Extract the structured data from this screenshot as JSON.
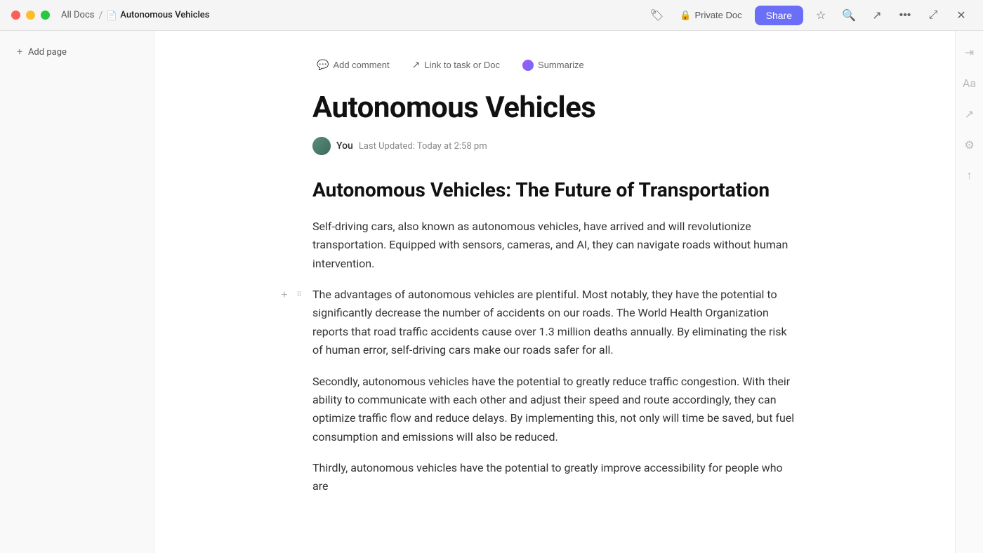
{
  "titlebar": {
    "breadcrumb_all": "All Docs",
    "breadcrumb_separator": "/",
    "breadcrumb_current": "Autonomous Vehicles",
    "private_label": "Private Doc",
    "share_label": "Share"
  },
  "sidebar": {
    "add_page_label": "Add page"
  },
  "toolbar": {
    "add_comment": "Add comment",
    "link_to_task": "Link to task or Doc",
    "summarize": "Summarize"
  },
  "document": {
    "title": "Autonomous Vehicles",
    "author": "You",
    "last_updated": "Last Updated: Today at 2:58 pm",
    "heading": "Autonomous Vehicles: The Future of Transportation",
    "para1": "Self-driving cars, also known as autonomous vehicles, have arrived and will revolutionize transportation. Equipped with sensors, cameras, and AI, they can navigate roads without human intervention.",
    "para2": "The advantages of autonomous vehicles are plentiful. Most notably, they have the potential to significantly decrease the number of accidents on our roads. The World Health Organization reports that road traffic accidents cause over 1.3 million deaths annually. By eliminating the risk of human error, self-driving cars make our roads safer for all.",
    "para3": "Secondly, autonomous vehicles have the potential to greatly reduce traffic congestion. With their ability to communicate with each other and adjust their speed and route accordingly, they can optimize traffic flow and reduce delays. By implementing this, not only will time be saved, but fuel consumption and emissions will also be reduced.",
    "para4": "Thirdly, autonomous vehicles have the potential to greatly improve accessibility for people who are"
  }
}
